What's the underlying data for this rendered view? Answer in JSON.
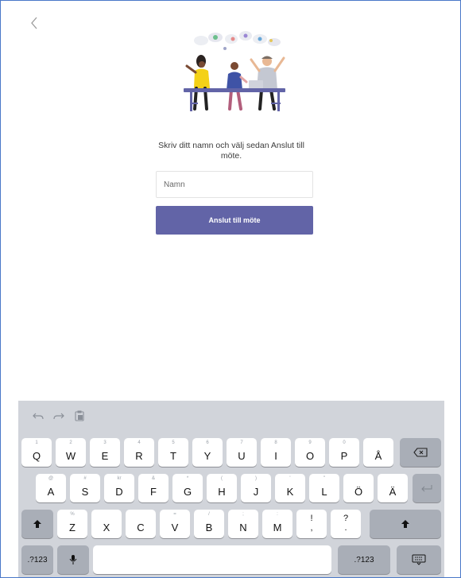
{
  "prompt": {
    "text": "Skriv ditt namn och välj sedan Anslut till möte."
  },
  "name_field": {
    "placeholder": "Namn",
    "value": ""
  },
  "join_button": {
    "label": "Anslut till möte"
  },
  "nav": {
    "back_icon": "chevron-left-icon"
  },
  "illustration": {
    "icon": "meeting-illustration"
  },
  "colors": {
    "accent": "#6264a7",
    "keyboard_bg": "#d1d4da",
    "frame_border": "#4a78c8"
  },
  "keyboard": {
    "tools": [
      {
        "icon": "undo-icon"
      },
      {
        "icon": "redo-icon"
      },
      {
        "icon": "paste-icon"
      }
    ],
    "row1": [
      {
        "label": "Q",
        "hint": "1"
      },
      {
        "label": "W",
        "hint": "2"
      },
      {
        "label": "E",
        "hint": "3"
      },
      {
        "label": "R",
        "hint": "4"
      },
      {
        "label": "T",
        "hint": "5"
      },
      {
        "label": "Y",
        "hint": "6"
      },
      {
        "label": "U",
        "hint": "7"
      },
      {
        "label": "I",
        "hint": "8"
      },
      {
        "label": "O",
        "hint": "9"
      },
      {
        "label": "P",
        "hint": "0"
      },
      {
        "label": "Å",
        "hint": ""
      }
    ],
    "row2": [
      {
        "label": "A",
        "hint": "@"
      },
      {
        "label": "S",
        "hint": "#"
      },
      {
        "label": "D",
        "hint": "kr"
      },
      {
        "label": "F",
        "hint": "&"
      },
      {
        "label": "G",
        "hint": "*"
      },
      {
        "label": "H",
        "hint": "("
      },
      {
        "label": "J",
        "hint": ")"
      },
      {
        "label": "K",
        "hint": "'"
      },
      {
        "label": "L",
        "hint": "\""
      },
      {
        "label": "Ö",
        "hint": ""
      },
      {
        "label": "Ä",
        "hint": ""
      }
    ],
    "row3": [
      {
        "label": "Z",
        "hint": "%"
      },
      {
        "label": "X",
        "hint": ""
      },
      {
        "label": "C",
        "hint": ""
      },
      {
        "label": "V",
        "hint": "="
      },
      {
        "label": "B",
        "hint": "/"
      },
      {
        "label": "N",
        "hint": ";"
      },
      {
        "label": "M",
        "hint": ":"
      }
    ],
    "punct": [
      {
        "top": "!",
        "bottom": ","
      },
      {
        "top": "?",
        "bottom": "."
      }
    ],
    "numbers_label": ".?123",
    "special_keys": {
      "backspace": "backspace-icon",
      "return": "return-icon",
      "shift": "shift-icon",
      "mic": "microphone-icon",
      "dismiss": "keyboard-hide-icon"
    }
  }
}
